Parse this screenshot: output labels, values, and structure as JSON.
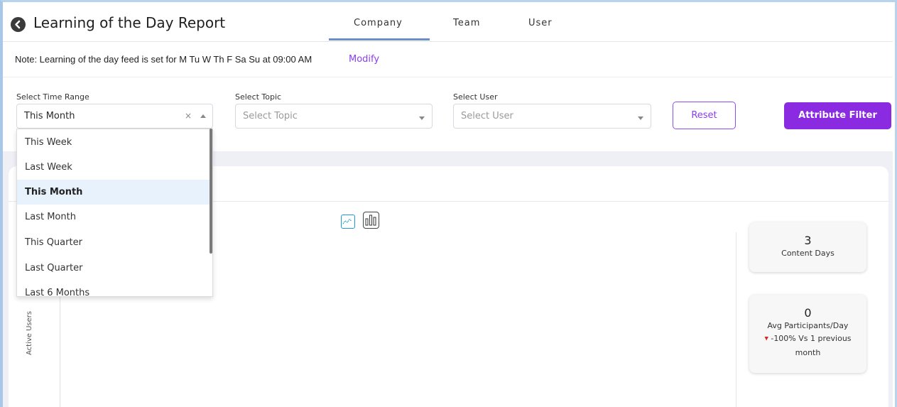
{
  "header": {
    "title": "Learning of the Day Report",
    "tabs": [
      {
        "label": "Company",
        "active": true
      },
      {
        "label": "Team",
        "active": false
      },
      {
        "label": "User",
        "active": false
      }
    ]
  },
  "note": {
    "text": "Note: Learning of the day feed is set for M Tu W Th F Sa Su at 09:00 AM",
    "link": "Modify"
  },
  "filters": {
    "time_range": {
      "label": "Select Time Range",
      "value": "This Month"
    },
    "topic": {
      "label": "Select Topic",
      "placeholder": "Select Topic"
    },
    "user": {
      "label": "Select User",
      "placeholder": "Select User"
    },
    "reset_label": "Reset",
    "attribute_label": "Attribute Filter"
  },
  "dropdown": {
    "options": [
      "This Week",
      "Last Week",
      "This Month",
      "Last Month",
      "This Quarter",
      "Last Quarter",
      "Last 6 Months"
    ],
    "selected": "This Month"
  },
  "chart": {
    "ylabel": "Active Users"
  },
  "stats": {
    "content_days": {
      "value": "3",
      "label": "Content Days"
    },
    "avg_participants": {
      "value": "0",
      "label": "Avg Participants/Day",
      "trend": "-100% Vs 1 previous month"
    }
  },
  "colors": {
    "accent": "#8a2be2",
    "tab_underline": "#6a8fc5",
    "trend_down": "#dd2222"
  }
}
